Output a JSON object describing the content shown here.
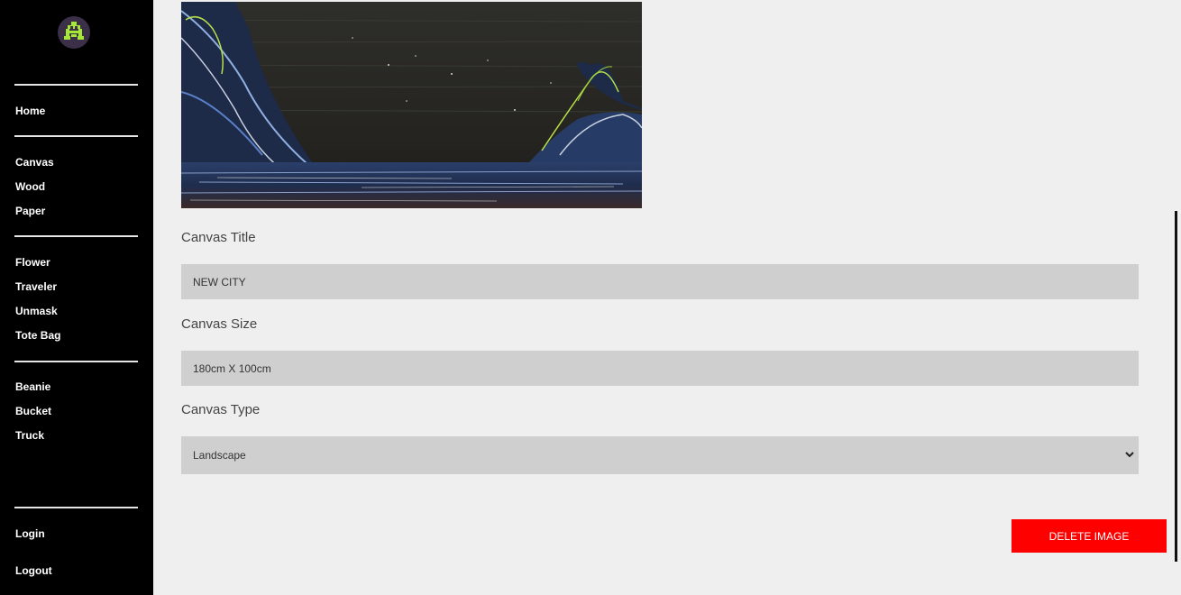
{
  "sidebar": {
    "logo_icon": "space-invader-icon",
    "nav": {
      "home": "Home",
      "canvas": "Canvas",
      "wood": "Wood",
      "paper": "Paper",
      "flower": "Flower",
      "traveler": "Traveler",
      "unmask": "Unmask",
      "tote_bag": "Tote Bag",
      "beanie": "Beanie",
      "bucket": "Bucket",
      "truck": "Truck",
      "login": "Login",
      "logout": "Logout"
    }
  },
  "form": {
    "title_label": "Canvas Title",
    "title_value": "NEW CITY",
    "size_label": "Canvas Size",
    "size_value": "180cm X 100cm",
    "type_label": "Canvas Type",
    "type_value": "Landscape"
  },
  "actions": {
    "delete_label": "DELETE IMAGE"
  },
  "colors": {
    "sidebar_bg": "#000000",
    "page_bg": "#efefef",
    "field_bg": "#cfcfcf",
    "delete_bg": "#ff0000",
    "logo_green": "#a6e635"
  }
}
